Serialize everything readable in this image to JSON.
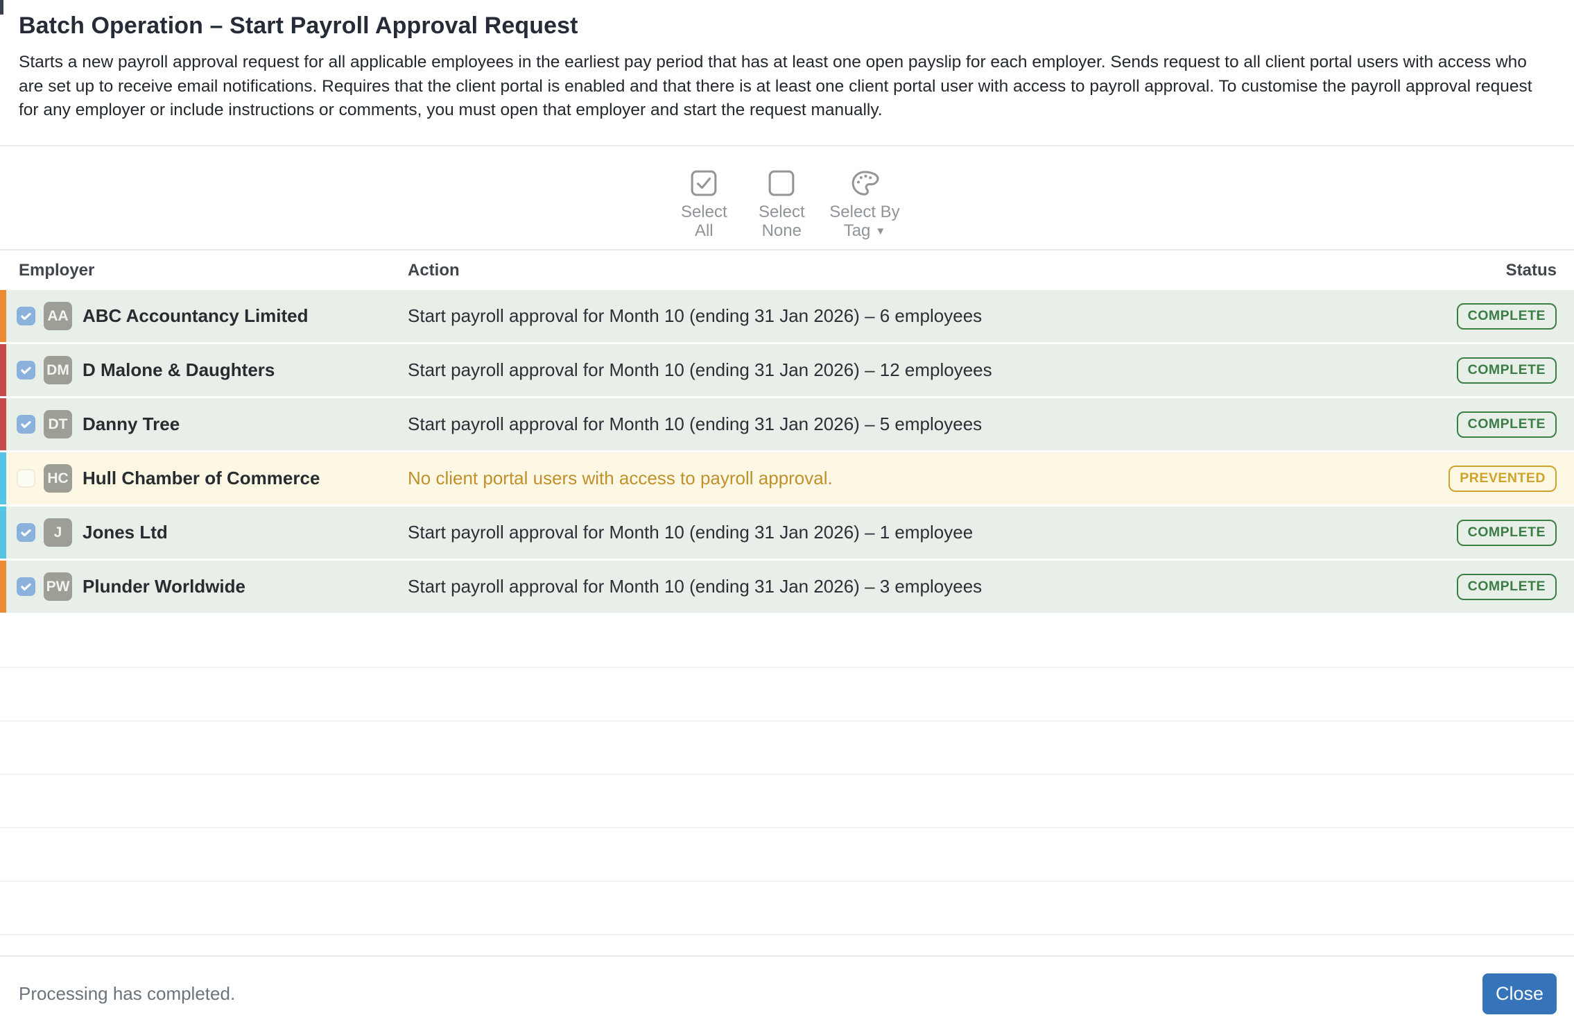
{
  "header": {
    "title": "Batch Operation – Start Payroll Approval Request",
    "description": "Starts a new payroll approval request for all applicable employees in the earliest pay period that has at least one open payslip for each employer. Sends request to all client portal users with access who are set up to receive email notifications. Requires that the client portal is enabled and that there is at least one client portal user with access to payroll approval. To customise the payroll approval request for any employer or include instructions or comments, you must open that employer and start the request manually."
  },
  "toolbar": {
    "buttons": [
      {
        "icon": "checkbox-checked-icon",
        "line1": "Select",
        "line2": "All"
      },
      {
        "icon": "checkbox-empty-icon",
        "line1": "Select",
        "line2": "None"
      },
      {
        "icon": "palette-icon",
        "line1": "Select By",
        "line2": "Tag",
        "caret": "▼"
      }
    ]
  },
  "table": {
    "columns": {
      "employer": "Employer",
      "action": "Action",
      "status": "Status"
    },
    "rows": [
      {
        "stripe_color": "#ec8b33",
        "checked": true,
        "initials": "AA",
        "employer": "ABC Accountancy Limited",
        "action": "Start payroll approval for Month 10 (ending 31 Jan 2026) – 6 employees",
        "status": "COMPLETE",
        "state": "complete"
      },
      {
        "stripe_color": "#c74a4d",
        "checked": true,
        "initials": "DM",
        "employer": "D Malone & Daughters",
        "action": "Start payroll approval for Month 10 (ending 31 Jan 2026) – 12 employees",
        "status": "COMPLETE",
        "state": "complete"
      },
      {
        "stripe_color": "#c74a4d",
        "checked": true,
        "initials": "DT",
        "employer": "Danny Tree",
        "action": "Start payroll approval for Month 10 (ending 31 Jan 2026) – 5 employees",
        "status": "COMPLETE",
        "state": "complete"
      },
      {
        "stripe_color": "#54c5e5",
        "checked": false,
        "initials": "HC",
        "employer": "Hull Chamber of Commerce",
        "action": "No client portal users with access to payroll approval.",
        "status": "PREVENTED",
        "state": "prevented"
      },
      {
        "stripe_color": "#54c5e5",
        "checked": true,
        "initials": "J",
        "employer": "Jones Ltd",
        "action": "Start payroll approval for Month 10 (ending 31 Jan 2026) – 1 employee",
        "status": "COMPLETE",
        "state": "complete"
      },
      {
        "stripe_color": "#ec8b33",
        "checked": true,
        "initials": "PW",
        "employer": "Plunder Worldwide",
        "action": "Start payroll approval for Month 10 (ending 31 Jan 2026) – 3 employees",
        "status": "COMPLETE",
        "state": "complete"
      }
    ],
    "empty_row_count": 6
  },
  "footer": {
    "status_text": "Processing has completed.",
    "close_label": "Close"
  },
  "colors": {
    "accent_blue": "#3674b9",
    "checkbox_blue": "#8bb2dc",
    "row_complete_bg": "#e8efe9",
    "row_prevented_bg": "#fdf8e4",
    "complete_green": "#3a7d45",
    "prevented_amber": "#cfa22b",
    "warning_text": "#c0902c",
    "stripe_orange": "#ec8b33",
    "stripe_red": "#c74a4d",
    "stripe_cyan": "#54c5e5",
    "avatar_gray": "#9d9e96",
    "toolbar_gray": "#8f9499"
  }
}
